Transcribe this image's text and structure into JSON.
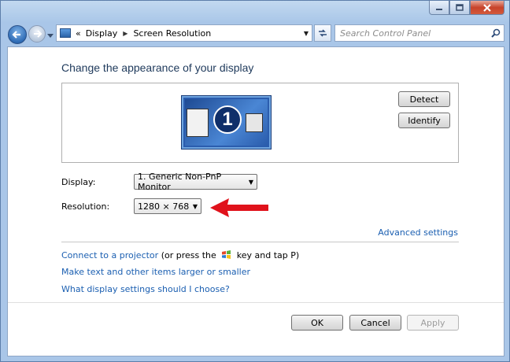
{
  "window": {
    "caption_buttons": [
      "minimize-icon",
      "maximize-icon",
      "close-icon"
    ]
  },
  "address_bar": {
    "breadcrumb": [
      "Display",
      "Screen Resolution"
    ],
    "overflow": "«"
  },
  "search": {
    "placeholder": "Search Control Panel"
  },
  "main": {
    "title": "Change the appearance of your display",
    "preview": {
      "monitor_number": "1",
      "detect_label": "Detect",
      "identify_label": "Identify"
    },
    "display_label": "Display:",
    "display_value": "1. Generic Non-PnP Monitor",
    "resolution_label": "Resolution:",
    "resolution_value": "1280 × 768",
    "advanced_link": "Advanced settings",
    "links": {
      "projector_link": "Connect to a projector",
      "projector_text_a": "(or press the",
      "projector_text_b": "key and tap P)",
      "text_size_link": "Make text and other items larger or smaller",
      "settings_help_link": "What display settings should I choose?"
    }
  },
  "footer": {
    "ok_label": "OK",
    "cancel_label": "Cancel",
    "apply_label": "Apply"
  },
  "colors": {
    "accent_link": "#1b5fb1",
    "title": "#1e395b",
    "annotation_arrow": "#e0121b"
  }
}
